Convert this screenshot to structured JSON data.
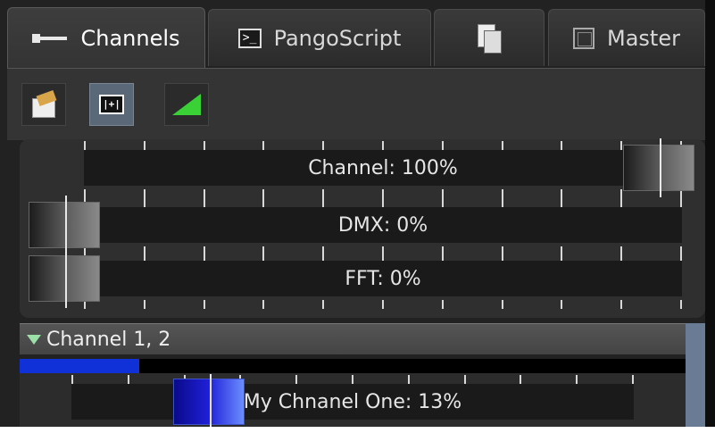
{
  "tabs": [
    {
      "label": "Channels",
      "icon": "channels-icon",
      "active": true
    },
    {
      "label": "PangoScript",
      "icon": "script-icon"
    },
    {
      "label": "",
      "icon": "pages-icon"
    },
    {
      "label": "Master",
      "icon": "master-icon"
    }
  ],
  "toolbar": {
    "buttons": [
      {
        "icon": "properties-icon"
      },
      {
        "icon": "mixer-icon",
        "active": true,
        "glyph": "|+|"
      },
      {
        "icon": "ramp-icon"
      }
    ]
  },
  "sliders": [
    {
      "label": "Channel: 100%",
      "value": 100
    },
    {
      "label": "DMX: 0%",
      "value": 0
    },
    {
      "label": "FFT: 0%",
      "value": 0
    }
  ],
  "channel_group": {
    "title": "Channel 1, 2",
    "level": 0.18,
    "channel": {
      "label": "My Chnanel One: 13%",
      "value": 13
    }
  },
  "colors": {
    "accent_blue": "#1030d8",
    "ramp_green": "#39d135",
    "group_strip": "#6a7c95"
  }
}
